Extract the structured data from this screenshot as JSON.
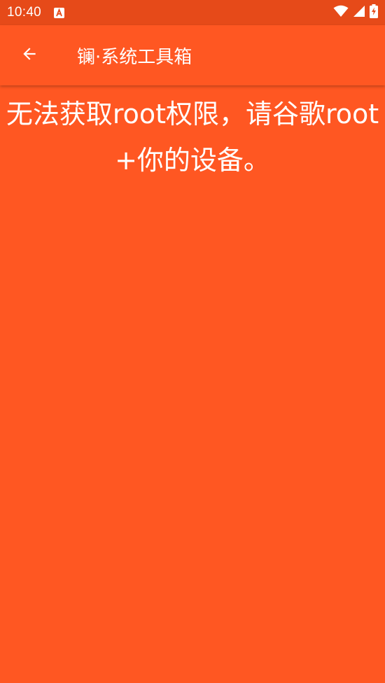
{
  "status_bar": {
    "time": "10:40",
    "icons": [
      "keyboard-a-icon",
      "wifi-icon",
      "signal-icon",
      "battery-charging-icon"
    ]
  },
  "app_bar": {
    "back_icon": "arrow-left-icon",
    "title": "镧·系统工具箱"
  },
  "main": {
    "message": "无法获取root权限，请谷歌root+你的设备。"
  },
  "colors": {
    "primary": "#FF5722",
    "status_bar": "#E64A19",
    "text": "#FFFFFF"
  }
}
